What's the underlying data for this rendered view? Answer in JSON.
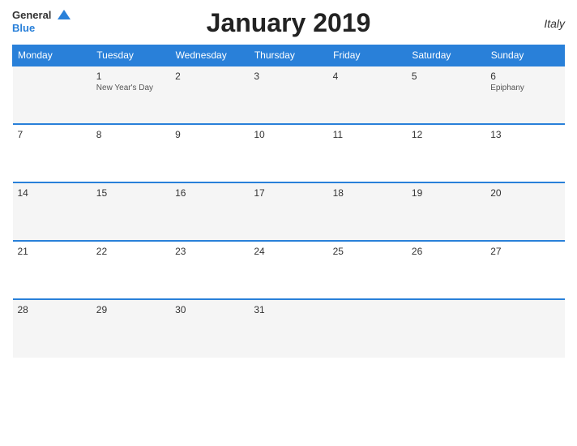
{
  "header": {
    "title": "January 2019",
    "country": "Italy"
  },
  "logo": {
    "general": "General",
    "blue": "Blue"
  },
  "weekdays": [
    "Monday",
    "Tuesday",
    "Wednesday",
    "Thursday",
    "Friday",
    "Saturday",
    "Sunday"
  ],
  "weeks": [
    [
      {
        "day": "",
        "holiday": ""
      },
      {
        "day": "1",
        "holiday": "New Year's Day"
      },
      {
        "day": "2",
        "holiday": ""
      },
      {
        "day": "3",
        "holiday": ""
      },
      {
        "day": "4",
        "holiday": ""
      },
      {
        "day": "5",
        "holiday": ""
      },
      {
        "day": "6",
        "holiday": "Epiphany"
      }
    ],
    [
      {
        "day": "7",
        "holiday": ""
      },
      {
        "day": "8",
        "holiday": ""
      },
      {
        "day": "9",
        "holiday": ""
      },
      {
        "day": "10",
        "holiday": ""
      },
      {
        "day": "11",
        "holiday": ""
      },
      {
        "day": "12",
        "holiday": ""
      },
      {
        "day": "13",
        "holiday": ""
      }
    ],
    [
      {
        "day": "14",
        "holiday": ""
      },
      {
        "day": "15",
        "holiday": ""
      },
      {
        "day": "16",
        "holiday": ""
      },
      {
        "day": "17",
        "holiday": ""
      },
      {
        "day": "18",
        "holiday": ""
      },
      {
        "day": "19",
        "holiday": ""
      },
      {
        "day": "20",
        "holiday": ""
      }
    ],
    [
      {
        "day": "21",
        "holiday": ""
      },
      {
        "day": "22",
        "holiday": ""
      },
      {
        "day": "23",
        "holiday": ""
      },
      {
        "day": "24",
        "holiday": ""
      },
      {
        "day": "25",
        "holiday": ""
      },
      {
        "day": "26",
        "holiday": ""
      },
      {
        "day": "27",
        "holiday": ""
      }
    ],
    [
      {
        "day": "28",
        "holiday": ""
      },
      {
        "day": "29",
        "holiday": ""
      },
      {
        "day": "30",
        "holiday": ""
      },
      {
        "day": "31",
        "holiday": ""
      },
      {
        "day": "",
        "holiday": ""
      },
      {
        "day": "",
        "holiday": ""
      },
      {
        "day": "",
        "holiday": ""
      }
    ]
  ]
}
